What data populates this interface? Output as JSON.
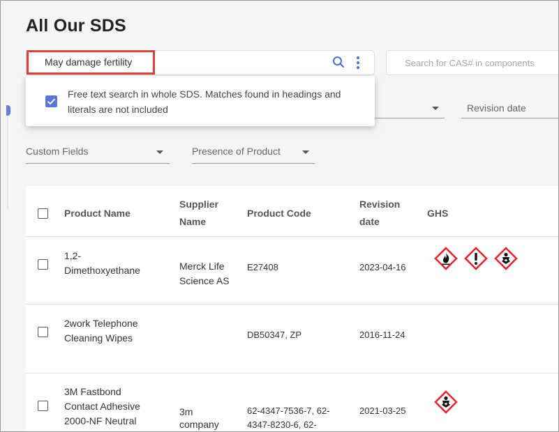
{
  "page": {
    "title": "All Our SDS"
  },
  "search": {
    "value": "May damage fertility",
    "cas_placeholder": "Search for CAS# in components",
    "options": {
      "free_text_label": "Free text search in whole SDS. Matches found in headings and literals are not included",
      "free_text_checked": true
    }
  },
  "filters": {
    "revision_date": "Revision date",
    "custom_fields": "Custom Fields",
    "presence_of_product": "Presence of Product"
  },
  "table": {
    "columns": {
      "product_name": "Product Name",
      "supplier_name_1": "Supplier",
      "supplier_name_2": "Name",
      "product_code": "Product Code",
      "revision_date_1": "Revision",
      "revision_date_2": "date",
      "ghs": "GHS"
    },
    "rows": [
      {
        "name_1": "1,2-",
        "name_2": "Dimethoxyethane",
        "name_3": "",
        "supplier_1": "Merck Life",
        "supplier_2": "Science AS",
        "code_1": "E27408",
        "code_2": "",
        "revision": "2023-04-16",
        "ghs_icons": [
          "flammable-icon",
          "exclamation-icon",
          "health-hazard-icon"
        ]
      },
      {
        "name_1": "2work Telephone",
        "name_2": "Cleaning Wipes",
        "name_3": "",
        "supplier_1": "",
        "supplier_2": "",
        "code_1": "DB50347, ZP",
        "code_2": "",
        "revision": "2016-11-24",
        "ghs_icons": []
      },
      {
        "name_1": "3M Fastbond",
        "name_2": "Contact Adhesive",
        "name_3": "2000-NF Neutral",
        "supplier_1": "3m",
        "supplier_2": "company",
        "code_1": "62-4347-7536-7, 62-",
        "code_2": "4347-8230-6, 62-",
        "revision": "2021-03-25",
        "ghs_icons": [
          "health-hazard-icon"
        ]
      }
    ]
  },
  "colors": {
    "highlight": "#e0403a",
    "accent": "#5876d8",
    "ghs_red": "#e3262d"
  }
}
